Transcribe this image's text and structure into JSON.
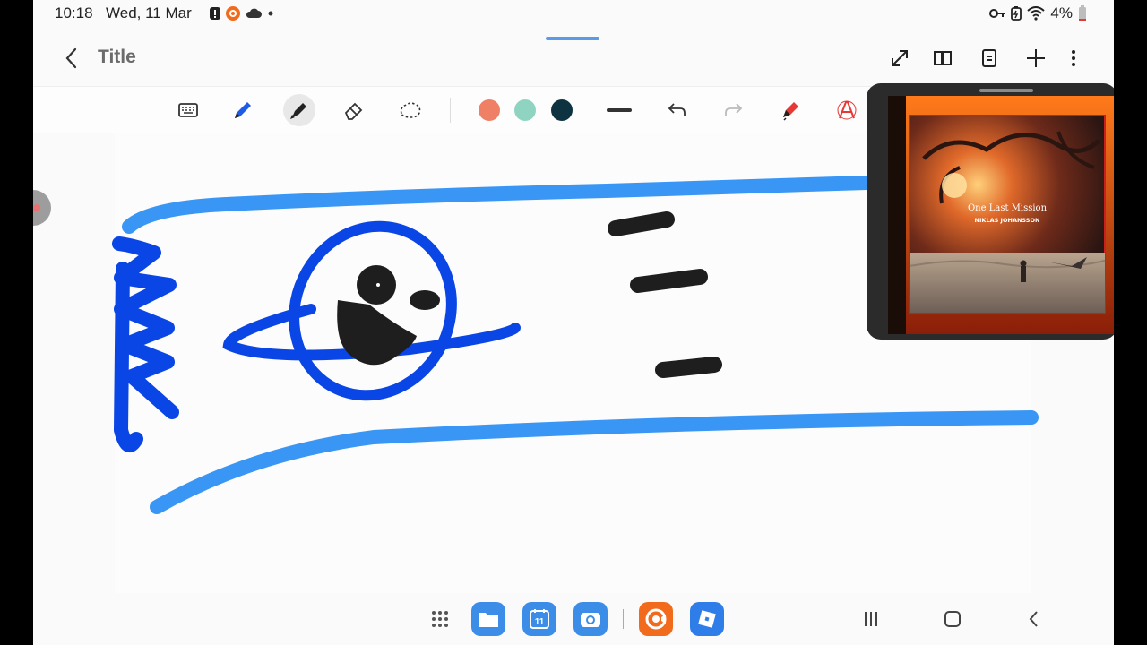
{
  "status_bar": {
    "time": "10:18",
    "date": "Wed, 11 Mar",
    "battery": "4%"
  },
  "app_bar": {
    "title": "Title",
    "actions": [
      "expand-icon",
      "book-view-icon",
      "page-icon",
      "add-icon",
      "more-icon"
    ]
  },
  "toolbar": {
    "tools": [
      {
        "name": "keyboard-icon",
        "active": false
      },
      {
        "name": "pen-icon",
        "active": false
      },
      {
        "name": "highlighter-icon",
        "active": true
      },
      {
        "name": "eraser-icon",
        "active": false
      },
      {
        "name": "lasso-icon",
        "active": false
      }
    ],
    "colors": [
      "#ef8066",
      "#8fd3c1",
      "#0d3340"
    ],
    "stroke": "line-weight-icon",
    "history": [
      "undo-icon",
      "redo-icon"
    ],
    "extras": [
      "pen-settings-icon",
      "text-recognition-icon"
    ]
  },
  "canvas": {
    "stroke_colors": {
      "light_blue": "#3a96f5",
      "dark_blue": "#0a46e6",
      "black": "#1e1e1e"
    }
  },
  "pip_player": {
    "album_title": "One Last Mission",
    "album_artist": "NIKLAS JOHANSSON"
  },
  "nav_bar": {
    "dock_apps": [
      "app-drawer-icon",
      "files-app-icon",
      "calendar-app-icon",
      "camera-app-icon",
      "screen-recorder-app-icon",
      "roblox-app-icon"
    ],
    "calendar_day": "11",
    "system_buttons": [
      "recents-icon",
      "home-icon",
      "back-icon"
    ]
  }
}
